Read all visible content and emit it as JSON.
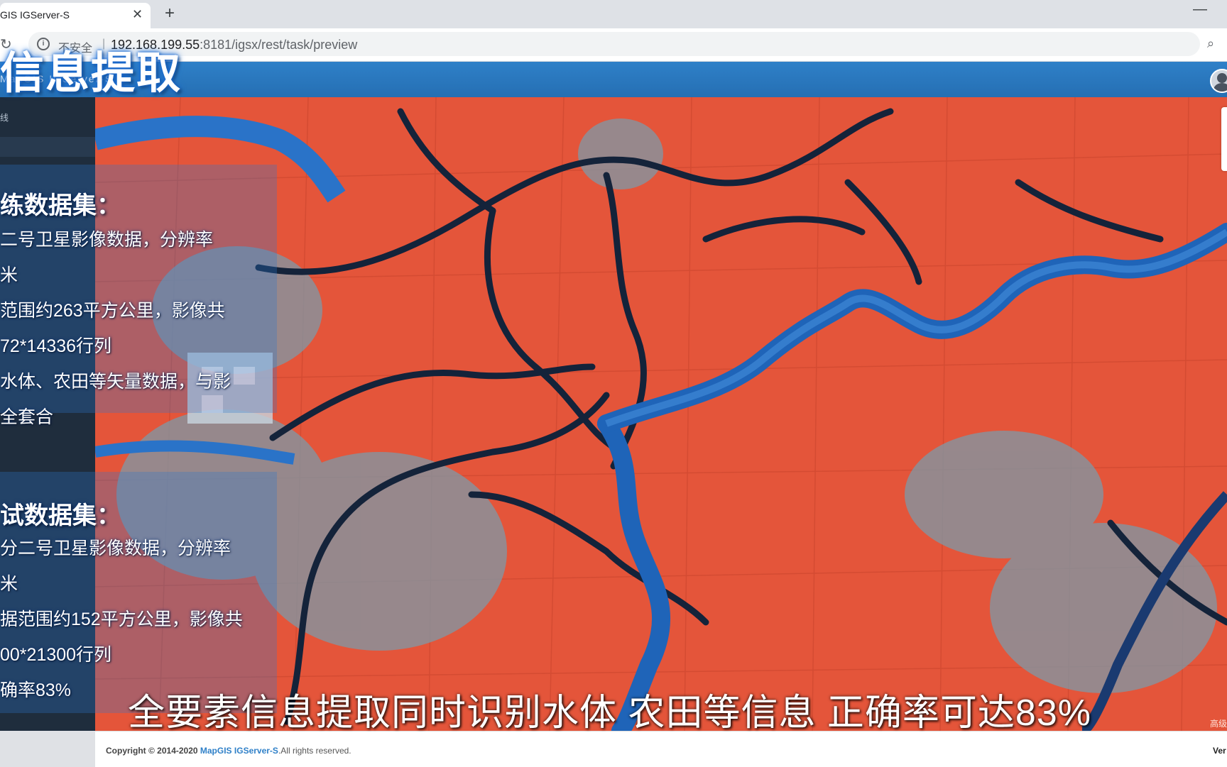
{
  "browser": {
    "tab_title": "GIS IGServer-S",
    "new_tab_icon": "plus",
    "security_label": "不安全",
    "url_host": "192.168.199.55",
    "url_path": ":8181/igsx/rest/task/preview"
  },
  "app": {
    "header_logo": "MapGIS IGServer-S",
    "sidebar_item": "线"
  },
  "overlay": {
    "title": "信息提取",
    "train_panel": {
      "heading": "练数据集：",
      "lines": [
        "二号卫星影像数据，分辨率",
        "米",
        "范围约263平方公里，影像共",
        "72*14336行列",
        "水体、农田等矢量数据，与影",
        "全套合"
      ]
    },
    "test_panel": {
      "heading": "试数据集：",
      "lines": [
        "分二号卫星影像数据，分辨率",
        "米",
        "据范围约152平方公里，影像共",
        "00*21300行列",
        "确率83%"
      ]
    },
    "subtitle": "全要素信息提取同时识别水体 农田等信息 正确率可达83%"
  },
  "map": {
    "attribution": "高级",
    "colors": {
      "farmland": "#e4553a",
      "water": "#1f64b8",
      "river_dark": "#14233a",
      "urban": "#6f8fa0"
    }
  },
  "footer": {
    "copyright_prefix": "Copyright © 2014-2020 ",
    "brand": "MapGIS IGServer-S",
    "rights": ".All rights reserved.",
    "version": "Ver"
  },
  "colors": {
    "header_blue": "#2f80c8",
    "sidebar_dark": "#1f2d3d"
  }
}
